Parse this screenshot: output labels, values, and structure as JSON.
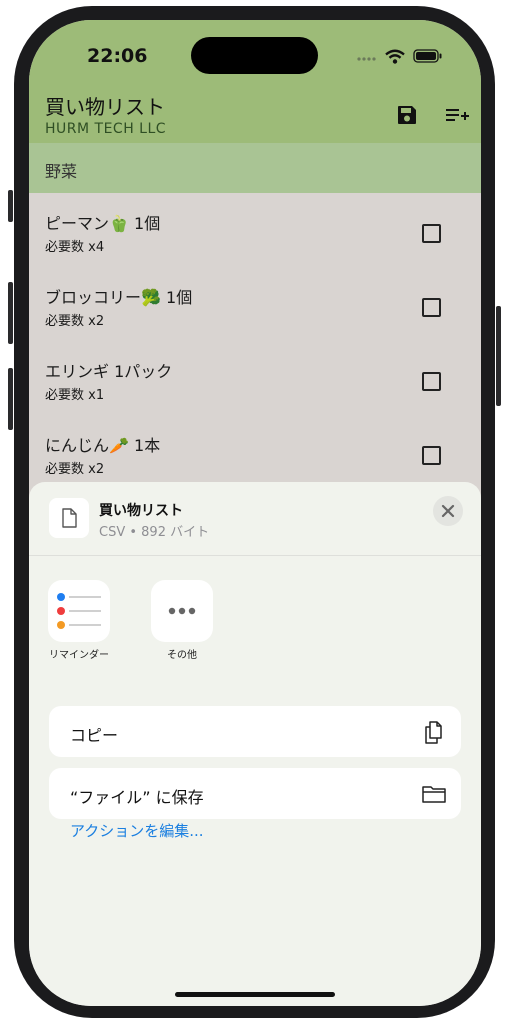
{
  "status_bar": {
    "time": "22:06"
  },
  "app": {
    "title": "買い物リスト",
    "subtitle": "HURM TECH LLC",
    "save_icon": "floppy-disk-icon",
    "add_list_icon": "playlist-add-icon"
  },
  "section": {
    "title": "野菜"
  },
  "items": [
    {
      "name": "ピーマン🫑 1個",
      "qty": "必要数 x4",
      "checked": false
    },
    {
      "name": "ブロッコリー🥦 1個",
      "qty": "必要数 x2",
      "checked": false
    },
    {
      "name": "エリンギ 1パック",
      "qty": "必要数 x1",
      "checked": false
    },
    {
      "name": "にんじん🥕 1本",
      "qty": "必要数 x2",
      "checked": false
    }
  ],
  "share_sheet": {
    "title": "買い物リスト",
    "subtitle": "CSV • 892 バイト",
    "apps": [
      {
        "label": "リマインダー",
        "icon": "reminders-icon"
      },
      {
        "label": "その他",
        "icon": "more-icon"
      }
    ],
    "actions": [
      {
        "label": "コピー",
        "icon": "copy-icon"
      },
      {
        "label": "“ファイル” に保存",
        "icon": "folder-icon"
      }
    ],
    "edit_actions": "アクションを編集..."
  },
  "colors": {
    "header_green": "#9dbb78",
    "section_green": "#a9c494",
    "link_blue": "#1b7fe0"
  }
}
